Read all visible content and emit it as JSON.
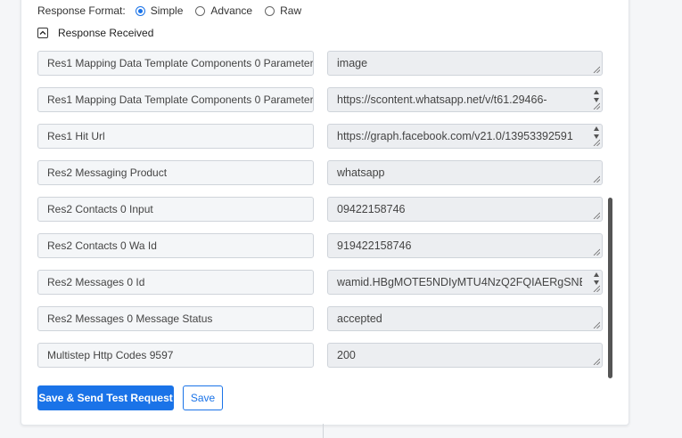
{
  "response_format": {
    "label": "Response Format:",
    "options": [
      {
        "label": "Simple",
        "selected": true
      },
      {
        "label": "Advance",
        "selected": false
      },
      {
        "label": "Raw",
        "selected": false
      }
    ]
  },
  "response_received": {
    "label": "Response Received",
    "expanded": true
  },
  "rows": [
    {
      "key": "Res1 Mapping Data Template Components 0 Parameters",
      "value": "image",
      "spinner": false
    },
    {
      "key": "Res1 Mapping Data Template Components 0 Parameters",
      "value": "https://scontent.whatsapp.net/v/t61.29466-",
      "spinner": true
    },
    {
      "key": "Res1 Hit Url",
      "value": "https://graph.facebook.com/v21.0/13953392591",
      "spinner": true
    },
    {
      "key": "Res2 Messaging Product",
      "value": "whatsapp",
      "spinner": false
    },
    {
      "key": "Res2 Contacts 0 Input",
      "value": "09422158746",
      "spinner": false
    },
    {
      "key": "Res2 Contacts 0 Wa Id",
      "value": "919422158746",
      "spinner": false
    },
    {
      "key": "Res2 Messages 0 Id",
      "value": "wamid.HBgMOTE5NDIyMTU4NzQ2FQIAERgSNE",
      "spinner": true
    },
    {
      "key": "Res2 Messages 0 Message Status",
      "value": "accepted",
      "spinner": false
    },
    {
      "key": " Multistep Http Codes 9597",
      "value": "200",
      "spinner": false
    }
  ],
  "buttons": {
    "save_send_label": "Save & Send Test Request",
    "save_label": "Save"
  },
  "colors": {
    "accent": "#1a73e8",
    "field_bg": "#eceef1",
    "key_bg": "#f4f6f8",
    "border": "#cfd4da"
  }
}
